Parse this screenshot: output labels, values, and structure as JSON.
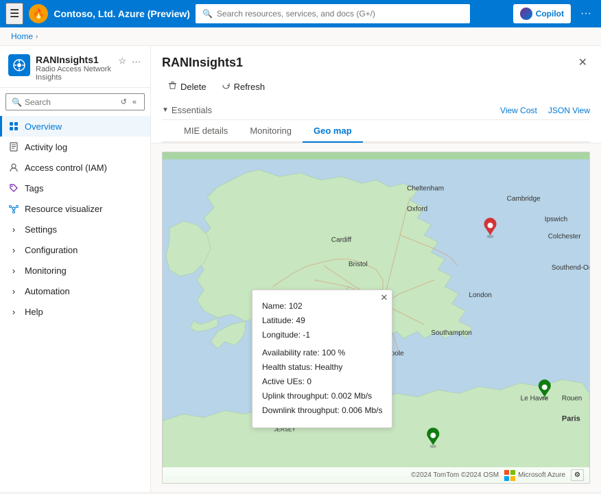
{
  "topbar": {
    "hamburger_icon": "☰",
    "org_name": "Contoso, Ltd. Azure (Preview)",
    "org_icon": "🔥",
    "search_placeholder": "Search resources, services, and docs (G+/)",
    "copilot_label": "Copilot",
    "ellipsis": "···"
  },
  "breadcrumb": {
    "home": "Home",
    "separator": "›"
  },
  "sidebar": {
    "resource_icon": "📡",
    "resource_name": "RANInsights1",
    "resource_subtitle": "Radio Access Network Insights",
    "favorite_icon": "☆",
    "more_icon": "···",
    "search_placeholder": "Search",
    "nav_items": [
      {
        "id": "overview",
        "label": "Overview",
        "icon": "⬜",
        "active": true,
        "has_chevron": false
      },
      {
        "id": "activity-log",
        "label": "Activity log",
        "icon": "📋",
        "active": false,
        "has_chevron": false
      },
      {
        "id": "access-control",
        "label": "Access control (IAM)",
        "icon": "👤",
        "active": false,
        "has_chevron": false
      },
      {
        "id": "tags",
        "label": "Tags",
        "icon": "🏷",
        "active": false,
        "has_chevron": false
      },
      {
        "id": "resource-visualizer",
        "label": "Resource visualizer",
        "icon": "🔗",
        "active": false,
        "has_chevron": false
      },
      {
        "id": "settings",
        "label": "Settings",
        "icon": null,
        "active": false,
        "has_chevron": true
      },
      {
        "id": "configuration",
        "label": "Configuration",
        "icon": null,
        "active": false,
        "has_chevron": true
      },
      {
        "id": "monitoring",
        "label": "Monitoring",
        "icon": null,
        "active": false,
        "has_chevron": true
      },
      {
        "id": "automation",
        "label": "Automation",
        "icon": null,
        "active": false,
        "has_chevron": true
      },
      {
        "id": "help",
        "label": "Help",
        "icon": null,
        "active": false,
        "has_chevron": true
      }
    ]
  },
  "content": {
    "title": "RANInsights1",
    "delete_label": "Delete",
    "refresh_label": "Refresh",
    "essentials_label": "Essentials",
    "view_cost_label": "View Cost",
    "json_view_label": "JSON View",
    "tabs": [
      {
        "id": "mie-details",
        "label": "MIE details",
        "active": false
      },
      {
        "id": "monitoring",
        "label": "Monitoring",
        "active": false
      },
      {
        "id": "geo-map",
        "label": "Geo map",
        "active": true
      }
    ]
  },
  "map": {
    "footer_copyright": "©2024 TomTom  ©2024 OSM",
    "footer_azure": "Microsoft Azure",
    "popup": {
      "name_label": "Name:",
      "name_value": "102",
      "latitude_label": "Latitude:",
      "latitude_value": "49",
      "longitude_label": "Longitude:",
      "longitude_value": "-1",
      "availability_label": "Availability rate:",
      "availability_value": "100 %",
      "health_label": "Health status:",
      "health_value": "Healthy",
      "active_ues_label": "Active UEs:",
      "active_ues_value": "0",
      "uplink_label": "Uplink throughput:",
      "uplink_value": "0.002 Mb/s",
      "downlink_label": "Downlink throughput:",
      "downlink_value": "0.006 Mb/s"
    }
  }
}
